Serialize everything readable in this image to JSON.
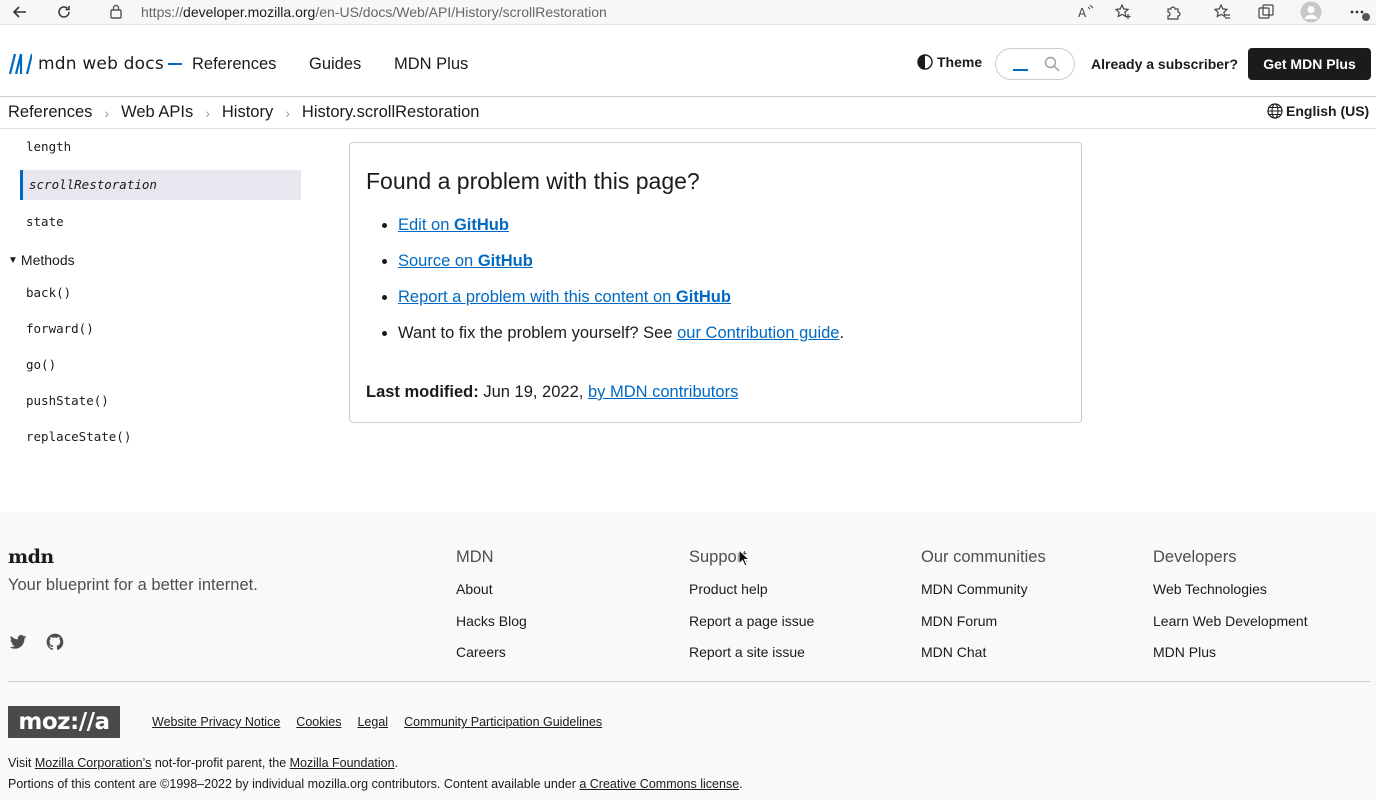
{
  "browser": {
    "url_scheme": "https://",
    "url_host": "developer.mozilla.org",
    "url_path": "/en-US/docs/Web/API/History/scrollRestoration"
  },
  "header": {
    "logo_text": "mdn web docs",
    "nav": [
      "References",
      "Guides",
      "MDN Plus"
    ],
    "theme_label": "Theme",
    "subscriber_label": "Already a subscriber?",
    "cta_label": "Get MDN Plus"
  },
  "breadcrumbs": [
    "References",
    "Web APIs",
    "History",
    "History.scrollRestoration"
  ],
  "language": "English (US)",
  "sidebar": {
    "items_top": [
      "length",
      "scrollRestoration",
      "state"
    ],
    "group_label": "Methods",
    "methods": [
      "back()",
      "forward()",
      "go()",
      "pushState()",
      "replaceState()"
    ]
  },
  "problem": {
    "title": "Found a problem with this page?",
    "edit_prefix": "Edit on ",
    "edit_strong": "GitHub",
    "source_prefix": "Source on ",
    "source_strong": "GitHub",
    "report_prefix": "Report a problem with this content on ",
    "report_strong": "GitHub",
    "fix_text": "Want to fix the problem yourself? See ",
    "fix_link": "our Contribution guide",
    "fix_end": ".",
    "last_mod_label": "Last modified:",
    "last_mod_date": " Jun 19, 2022, ",
    "last_mod_link": "by MDN contributors"
  },
  "footer": {
    "logo": "mdn",
    "tagline": "Your blueprint for a better internet.",
    "columns": [
      {
        "title": "MDN",
        "links": [
          "About",
          "Hacks Blog",
          "Careers"
        ]
      },
      {
        "title": "Support",
        "links": [
          "Product help",
          "Report a page issue",
          "Report a site issue"
        ]
      },
      {
        "title": "Our communities",
        "links": [
          "MDN Community",
          "MDN Forum",
          "MDN Chat"
        ]
      },
      {
        "title": "Developers",
        "links": [
          "Web Technologies",
          "Learn Web Development",
          "MDN Plus"
        ]
      }
    ],
    "mozilla_logo": "moz://a",
    "legal_links": [
      "Website Privacy Notice",
      "Cookies",
      "Legal",
      "Community Participation Guidelines"
    ],
    "visit_prefix": "Visit ",
    "visit_link1": "Mozilla Corporation’s",
    "visit_mid": " not-for-profit parent, the ",
    "visit_link2": "Mozilla Foundation",
    "visit_end": ".",
    "portions_text": "Portions of this content are ©1998–2022 by individual mozilla.org contributors. Content available under ",
    "portions_link": "a Creative Commons license",
    "portions_end": "."
  },
  "colors": {
    "accent": "#0069c2",
    "active_bg": "#e8e6ef",
    "cta_bg": "#1b1b1b"
  }
}
